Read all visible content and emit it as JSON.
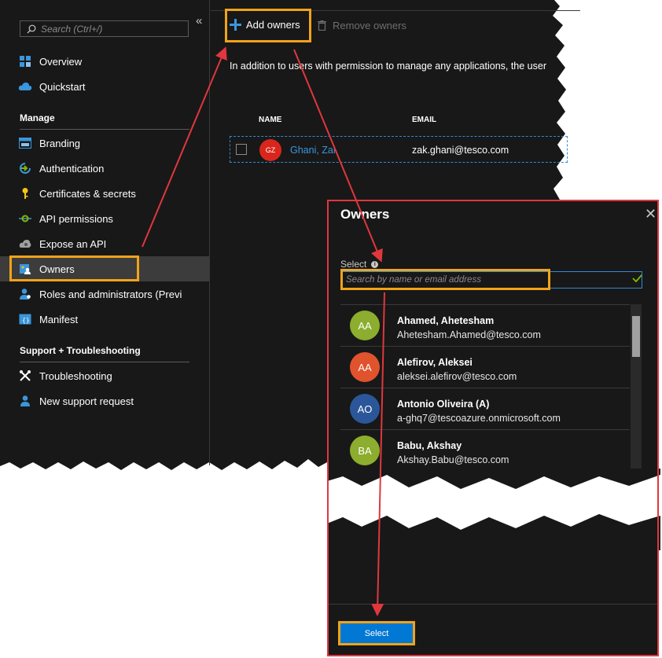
{
  "search": {
    "placeholder": "Search (Ctrl+/)"
  },
  "sidebar": {
    "collapse_glyph": "«",
    "top_items": [
      {
        "label": "Overview",
        "icon": "overview-icon"
      },
      {
        "label": "Quickstart",
        "icon": "cloud-icon"
      }
    ],
    "manage_heading": "Manage",
    "manage_items": [
      {
        "label": "Branding",
        "icon": "branding-icon"
      },
      {
        "label": "Authentication",
        "icon": "authentication-icon"
      },
      {
        "label": "Certificates & secrets",
        "icon": "key-icon"
      },
      {
        "label": "API permissions",
        "icon": "api-permissions-icon"
      },
      {
        "label": "Expose an API",
        "icon": "cloud-gear-icon"
      },
      {
        "label": "Owners",
        "icon": "owners-icon",
        "selected": true
      },
      {
        "label": "Roles and administrators (Previ",
        "icon": "roles-icon"
      },
      {
        "label": "Manifest",
        "icon": "manifest-icon"
      }
    ],
    "support_heading": "Support + Troubleshooting",
    "support_items": [
      {
        "label": "Troubleshooting",
        "icon": "wrench-icon"
      },
      {
        "label": "New support request",
        "icon": "support-request-icon"
      }
    ]
  },
  "toolbar": {
    "add_owners_label": "Add owners",
    "remove_owners_label": "Remove owners"
  },
  "main": {
    "info_text": "In addition to users with permission to manage any applications, the user",
    "table": {
      "headers": [
        "NAME",
        "EMAIL"
      ],
      "rows": [
        {
          "initials": "GZ",
          "name": "Ghani, Zak",
          "email": "zak.ghani@tesco.com"
        }
      ]
    }
  },
  "panel": {
    "title": "Owners",
    "close_glyph": "✕",
    "select_label": "Select",
    "search_placeholder": "Search by name or email address",
    "users": [
      {
        "initials": "AA",
        "name": "Ahamed, Ahetesham",
        "email": "Ahetesham.Ahamed@tesco.com",
        "color": "#8cad2d"
      },
      {
        "initials": "AA",
        "name": "Alefirov, Aleksei",
        "email": "aleksei.alefirov@tesco.com",
        "color": "#e0532d"
      },
      {
        "initials": "AO",
        "name": "Antonio Oliveira (A)",
        "email": "a-ghq7@tescoazure.onmicrosoft.com",
        "color": "#2b579a"
      },
      {
        "initials": "BA",
        "name": "Babu, Akshay",
        "email": "Akshay.Babu@tesco.com",
        "color": "#8cad2d"
      }
    ],
    "select_button_label": "Select"
  },
  "colors": {
    "background": "#181818",
    "accent": "#0078d4",
    "highlight": "#f2a318",
    "arrow": "#e0373d"
  }
}
